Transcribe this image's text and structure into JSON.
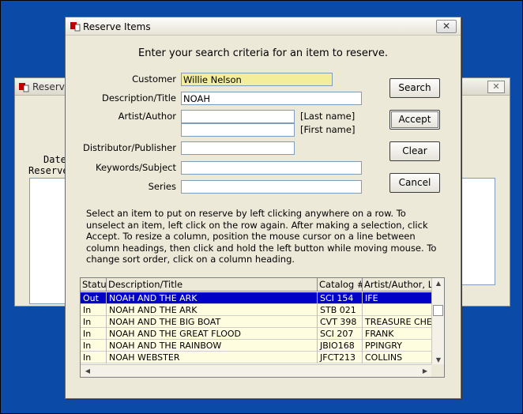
{
  "background_window": {
    "title": "Reserve",
    "date_label": "Date",
    "reserve_label": "Reserve"
  },
  "dialog": {
    "title": "Reserve Items",
    "close_glyph": "✕",
    "heading": "Enter your search criteria for an item to reserve.",
    "fields": {
      "customer": {
        "label": "Customer",
        "value": "Willie Nelson"
      },
      "description": {
        "label": "Description/Title",
        "value": "NOAH"
      },
      "artist": {
        "label": "Artist/Author",
        "last_value": "",
        "first_value": "",
        "last_hint": "[Last name]",
        "first_hint": "[First name]"
      },
      "distributor": {
        "label": "Distributor/Publisher",
        "value": ""
      },
      "keywords": {
        "label": "Keywords/Subject",
        "value": ""
      },
      "series": {
        "label": "Series",
        "value": ""
      }
    },
    "buttons": {
      "search": "Search",
      "accept": "Accept",
      "clear": "Clear",
      "cancel": "Cancel"
    },
    "instructions": "Select an item to put on reserve by left clicking anywhere on a row.  To unselect an item, left click on the row again.  After making a selection, click Accept.  To resize a column, position the mouse cursor on a line between column headings, then click and hold the left button while moving mouse.  To change sort order, click on a column heading."
  },
  "grid": {
    "columns": [
      "Statu",
      "Description/Title",
      "Catalog #",
      "Artist/Author, L"
    ],
    "rows": [
      {
        "status": "Out",
        "title": "NOAH AND THE ARK",
        "catalog": "SCI 154",
        "artist": "IFE",
        "selected": true
      },
      {
        "status": "In",
        "title": "NOAH AND THE ARK",
        "catalog": "STB 021",
        "artist": ""
      },
      {
        "status": "In",
        "title": "NOAH AND THE BIG BOAT",
        "catalog": "CVT 398",
        "artist": "TREASURE CHE"
      },
      {
        "status": "In",
        "title": "NOAH AND THE GREAT FLOOD",
        "catalog": "SCI 207",
        "artist": "FRANK"
      },
      {
        "status": "In",
        "title": "NOAH AND THE RAINBOW",
        "catalog": "JBIO168",
        "artist": "PPINGRY"
      },
      {
        "status": "In",
        "title": "NOAH WEBSTER",
        "catalog": "JFCT213",
        "artist": "COLLINS"
      }
    ],
    "colors": {
      "row": "#fffde0",
      "selected": "#0000c8"
    }
  }
}
